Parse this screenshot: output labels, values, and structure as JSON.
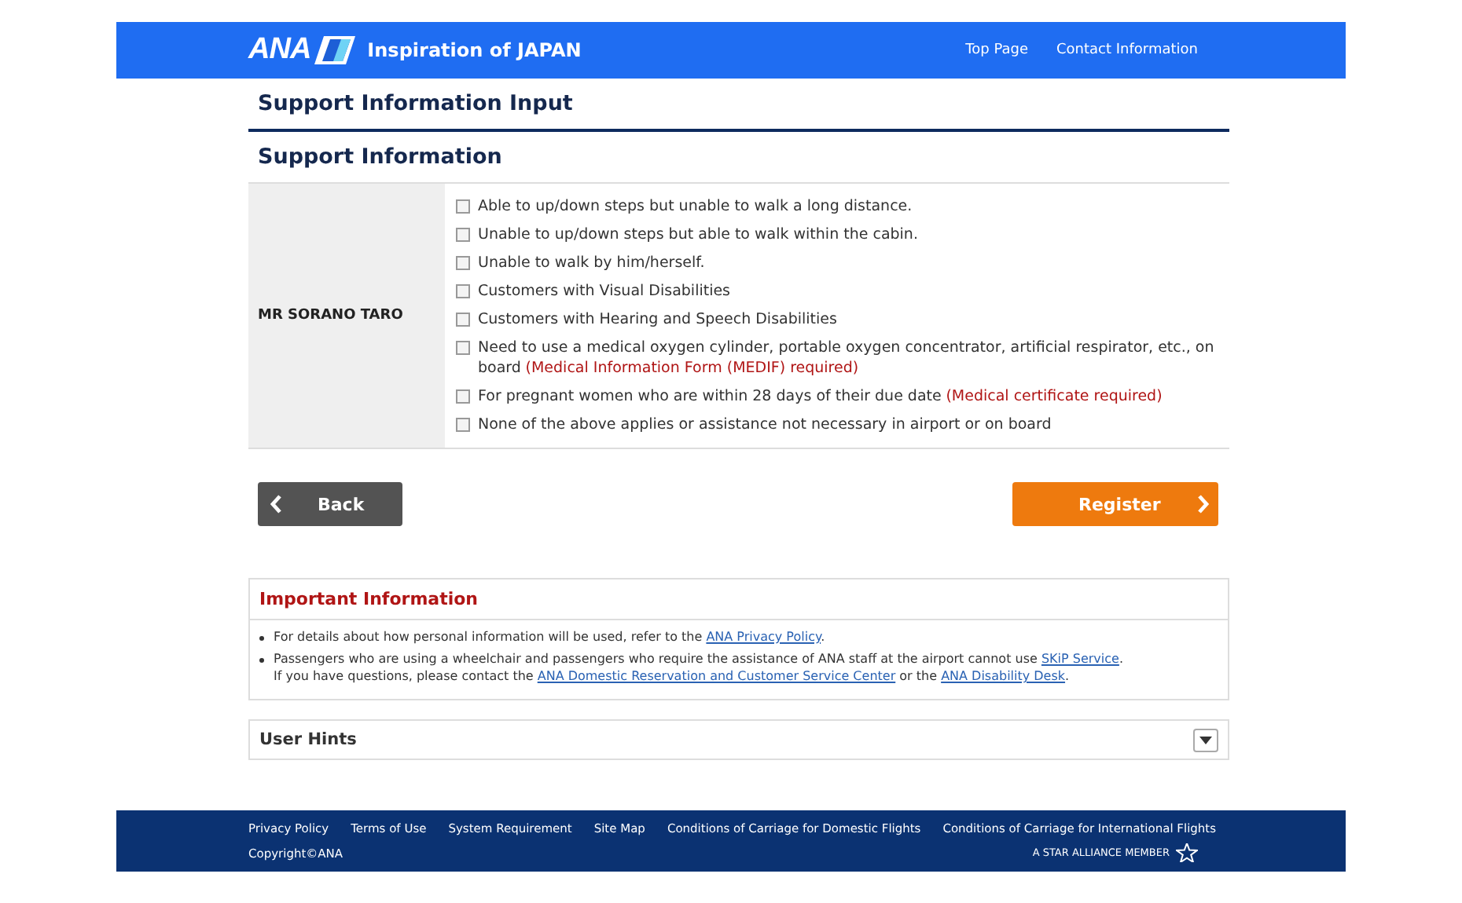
{
  "header": {
    "logo": "ANA",
    "tagline": "Inspiration of JAPAN",
    "links": [
      "Top Page",
      "Contact Information"
    ]
  },
  "page_title": "Support Information Input",
  "section_title": "Support Information",
  "passenger": "MR SORANO TARO",
  "options": [
    {
      "label": "Able to up/down steps but unable to walk a long distance.",
      "checked": false
    },
    {
      "label": "Unable to up/down steps but able to walk within the cabin.",
      "checked": false
    },
    {
      "label": "Unable to walk by him/herself.",
      "checked": false
    },
    {
      "label": "Customers with Visual Disabilities",
      "checked": false
    },
    {
      "label": "Customers with Hearing and Speech Disabilities",
      "checked": false
    },
    {
      "label": "Need to use a medical oxygen cylinder, portable oxygen concentrator, artificial respirator, etc., on board",
      "note": "(Medical Information Form (MEDIF) required)",
      "checked": false
    },
    {
      "label": "For pregnant women who are within 28 days of their due date",
      "note": "(Medical certificate required)",
      "checked": false
    },
    {
      "label": "None of the above applies or assistance not necessary in airport or on board",
      "checked": false
    }
  ],
  "buttons": {
    "back": "Back",
    "register": "Register"
  },
  "important": {
    "title": "Important Information",
    "items": [
      {
        "lines": [
          [
            {
              "kind": "text",
              "text": "For details about how personal information will be used, refer to the "
            },
            {
              "kind": "link",
              "text": "ANA Privacy Policy"
            },
            {
              "kind": "text",
              "text": "."
            }
          ]
        ]
      },
      {
        "lines": [
          [
            {
              "kind": "text",
              "text": "Passengers who are using a wheelchair and passengers who require the assistance of ANA staff at the airport cannot use "
            },
            {
              "kind": "link",
              "text": "SKiP Service"
            },
            {
              "kind": "text",
              "text": "."
            }
          ],
          [
            {
              "kind": "text",
              "text": "If you have questions, please contact the "
            },
            {
              "kind": "link",
              "text": "ANA Domestic Reservation and Customer Service Center"
            },
            {
              "kind": "text",
              "text": " or the "
            },
            {
              "kind": "link",
              "text": "ANA Disability Desk"
            },
            {
              "kind": "text",
              "text": "."
            }
          ]
        ]
      }
    ]
  },
  "hints": {
    "title": "User Hints",
    "expanded": false
  },
  "footer": {
    "links": [
      "Privacy Policy",
      "Terms of Use",
      "System Requirement",
      "Site Map",
      "Conditions of Carriage for Domestic Flights",
      "Conditions of Carriage for International Flights"
    ],
    "copyright": "Copyright©ANA",
    "alliance": "A STAR ALLIANCE MEMBER"
  }
}
